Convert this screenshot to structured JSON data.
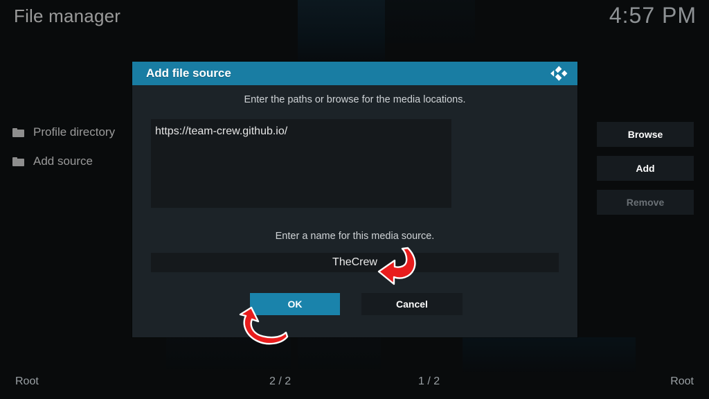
{
  "window": {
    "title": "File manager",
    "clock": "4:57 PM"
  },
  "sidebar": {
    "items": [
      {
        "label": "Profile directory",
        "icon": "folder-icon"
      },
      {
        "label": "Add source",
        "icon": "folder-icon"
      }
    ]
  },
  "dialog": {
    "title": "Add file source",
    "logo_icon": "kodi-logo-icon",
    "hint_paths": "Enter the paths or browse for the media locations.",
    "paths": [
      "https://team-crew.github.io/"
    ],
    "side_buttons": [
      {
        "label": "Browse",
        "enabled": true
      },
      {
        "label": "Add",
        "enabled": true
      },
      {
        "label": "Remove",
        "enabled": false
      }
    ],
    "hint_name": "Enter a name for this media source.",
    "name_value": "TheCrew",
    "ok_label": "OK",
    "cancel_label": "Cancel"
  },
  "annotations": [
    {
      "name": "arrow-pointing-to-name-field",
      "color": "#e81c1c"
    },
    {
      "name": "arrow-pointing-to-ok-button",
      "color": "#e81c1c"
    }
  ],
  "statusbar": {
    "left": "Root",
    "middle_left": "2 / 2",
    "middle_right": "1 / 2",
    "right": "Root"
  },
  "colors": {
    "accent": "#197da3",
    "dialog_bg": "#1c2328",
    "field_bg": "#15191c",
    "annotation_red": "#e81c1c"
  }
}
